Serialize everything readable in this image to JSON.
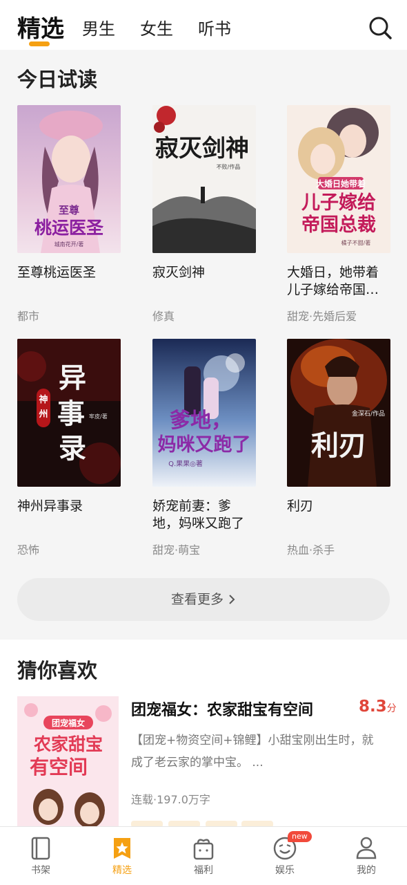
{
  "top_tabs": [
    "精选",
    "男生",
    "女生",
    "听书"
  ],
  "section_trial": {
    "title": "今日试读",
    "books": [
      {
        "title": "至尊桃运医圣",
        "category": "都市",
        "cover_text": "至尊桃运医圣",
        "cover_author": "城南花开/著"
      },
      {
        "title": "寂灭剑神",
        "category": "修真",
        "cover_text": "寂灭剑神",
        "cover_author": "不败/作品"
      },
      {
        "title": "大婚日，她带着儿子嫁给帝国…",
        "category": "甜宠·先婚后爱",
        "cover_text_top": "大婚日她带着",
        "cover_text": "儿子嫁给帝国总裁",
        "cover_author": "橘子不甜/著"
      },
      {
        "title": "神州异事录",
        "category": "恐怖",
        "cover_text": "异事录",
        "cover_side": "神州",
        "cover_author": "牢皮/著"
      },
      {
        "title": "娇宠前妻：爹地，妈咪又跑了",
        "category": "甜宠·萌宝",
        "cover_text": "爹地，妈咪又跑了",
        "cover_author": "Q.果果◎著"
      },
      {
        "title": "利刃",
        "category": "热血·杀手",
        "cover_text": "利刃",
        "cover_author": "金深石/作品"
      }
    ],
    "more_label": "查看更多"
  },
  "section_guess": {
    "title": "猜你喜欢",
    "book": {
      "title": "团宠福女：农家甜宝有空间",
      "score": "8.3",
      "score_unit": "分",
      "description": "【团宠+物资空间+锦鲤】小甜宝刚出生时，就成了老云家的掌中宝。 ...",
      "meta": "连载·197.0万字",
      "cover_badge": "团宠福女",
      "cover_text": "农家甜宝有空间"
    }
  },
  "bottom_nav": [
    {
      "label": "书架",
      "icon": "bookshelf-icon"
    },
    {
      "label": "精选",
      "icon": "featured-icon"
    },
    {
      "label": "福利",
      "icon": "gift-icon"
    },
    {
      "label": "娱乐",
      "icon": "entertainment-icon",
      "badge": "new"
    },
    {
      "label": "我的",
      "icon": "profile-icon"
    }
  ],
  "colors": {
    "accent": "#f5a012",
    "score": "#e0463a",
    "badge": "#f14a3b"
  }
}
